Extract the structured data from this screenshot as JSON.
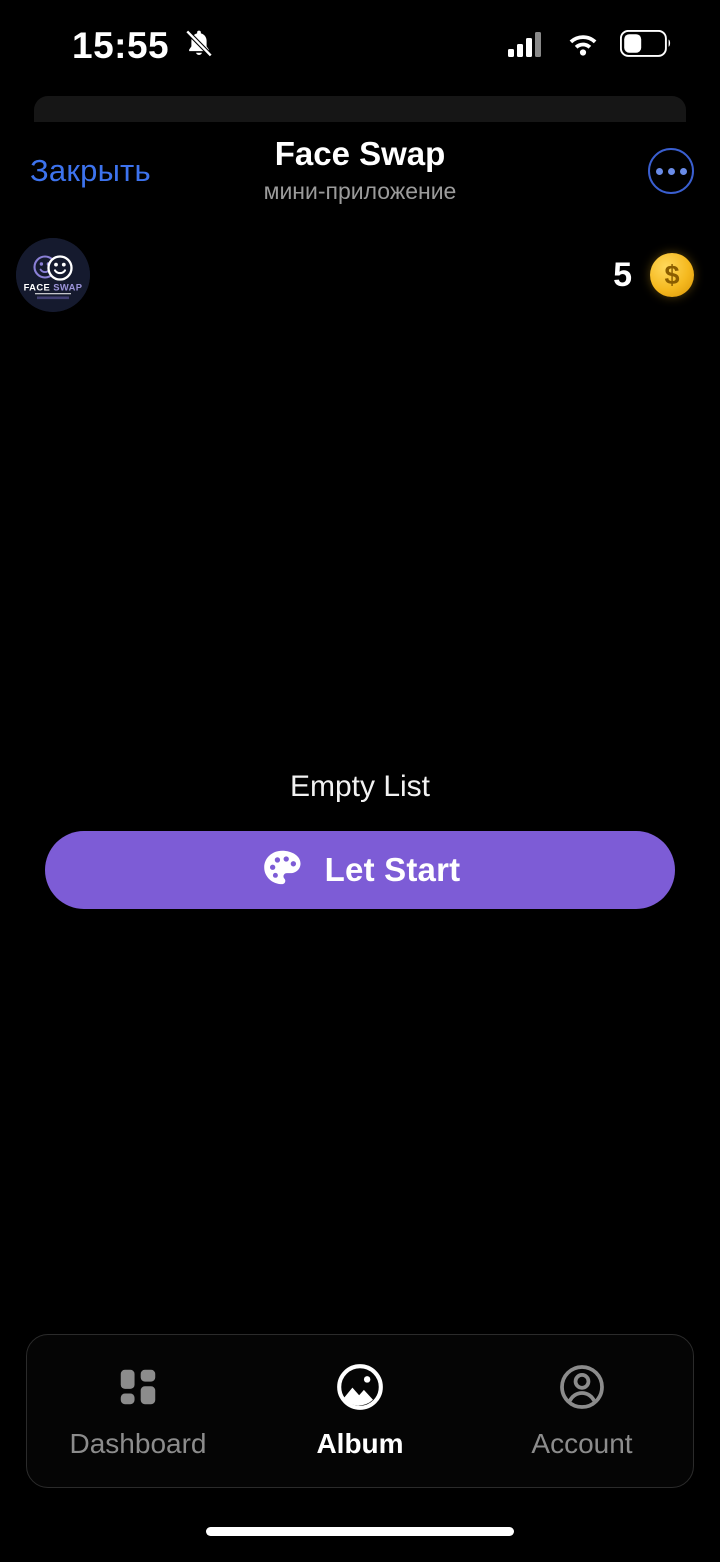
{
  "status_bar": {
    "time": "15:55",
    "icons": {
      "notifications": "bell-slash-icon",
      "cellular": "signal-bars-icon",
      "wifi": "wifi-icon",
      "battery": "battery-icon"
    }
  },
  "header": {
    "close_label": "Закрыть",
    "title": "Face Swap",
    "subtitle": "мини-приложение",
    "menu_icon": "more-options-icon",
    "close_color": "#3d73ee",
    "menu_border_color": "#3a5fd0"
  },
  "app_bar": {
    "logo_name": "face-swap-logo",
    "logo_text_primary": "FACE",
    "logo_text_secondary": "SWAP",
    "balance_count": "5",
    "coin_symbol": "$",
    "coin_color": "#f5b91f"
  },
  "main": {
    "empty_text": "Empty List",
    "start_button_label": "Let Start",
    "start_button_icon": "palette-icon",
    "start_button_color": "#7d5cd6"
  },
  "bottom_nav": {
    "items": [
      {
        "label": "Dashboard",
        "icon": "grid-icon",
        "active": false
      },
      {
        "label": "Album",
        "icon": "image-circle-icon",
        "active": true
      },
      {
        "label": "Account",
        "icon": "person-circle-icon",
        "active": false
      }
    ]
  }
}
